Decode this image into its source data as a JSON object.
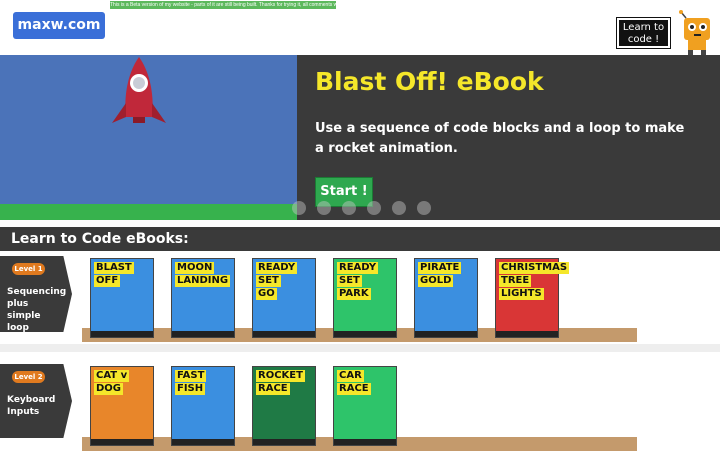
{
  "banner": {
    "text": "This is a Beta version of my website - parts of it are still being built. Thanks for trying it, all comments welcome! Max"
  },
  "header": {
    "logo": "maxw.com",
    "learn_button": "Learn to code !"
  },
  "hero": {
    "title": "Blast Off! eBook",
    "description": "Use a sequence of code blocks and a loop to make a rocket animation.",
    "start_label": "Start !",
    "dots": 6
  },
  "section": {
    "title": "Learn to Code eBooks:"
  },
  "levels": [
    {
      "badge": "Level 1",
      "name": "Sequencing plus simple loop",
      "books": [
        {
          "title": [
            "BLAST",
            "OFF"
          ],
          "color": "#3b8fe0"
        },
        {
          "title": [
            "MOON",
            "LANDING"
          ],
          "color": "#3b8fe0"
        },
        {
          "title": [
            "READY",
            "SET",
            "GO"
          ],
          "color": "#3b8fe0"
        },
        {
          "title": [
            "READY",
            "SET",
            "PARK"
          ],
          "color": "#2ec46a"
        },
        {
          "title": [
            "PIRATE",
            "GOLD"
          ],
          "color": "#3b8fe0"
        },
        {
          "title": [
            "CHRISTMAS",
            "TREE",
            "LIGHTS"
          ],
          "color": "#d93636"
        }
      ]
    },
    {
      "badge": "Level 2",
      "name": "Keyboard Inputs",
      "books": [
        {
          "title": [
            "CAT v",
            "DOG"
          ],
          "color": "#e8862a"
        },
        {
          "title": [
            "FAST",
            "FISH"
          ],
          "color": "#3b8fe0"
        },
        {
          "title": [
            "ROCKET",
            "RACE"
          ],
          "color": "#1f7a45"
        },
        {
          "title": [
            "CAR",
            "RACE"
          ],
          "color": "#2ec46a"
        }
      ]
    }
  ]
}
